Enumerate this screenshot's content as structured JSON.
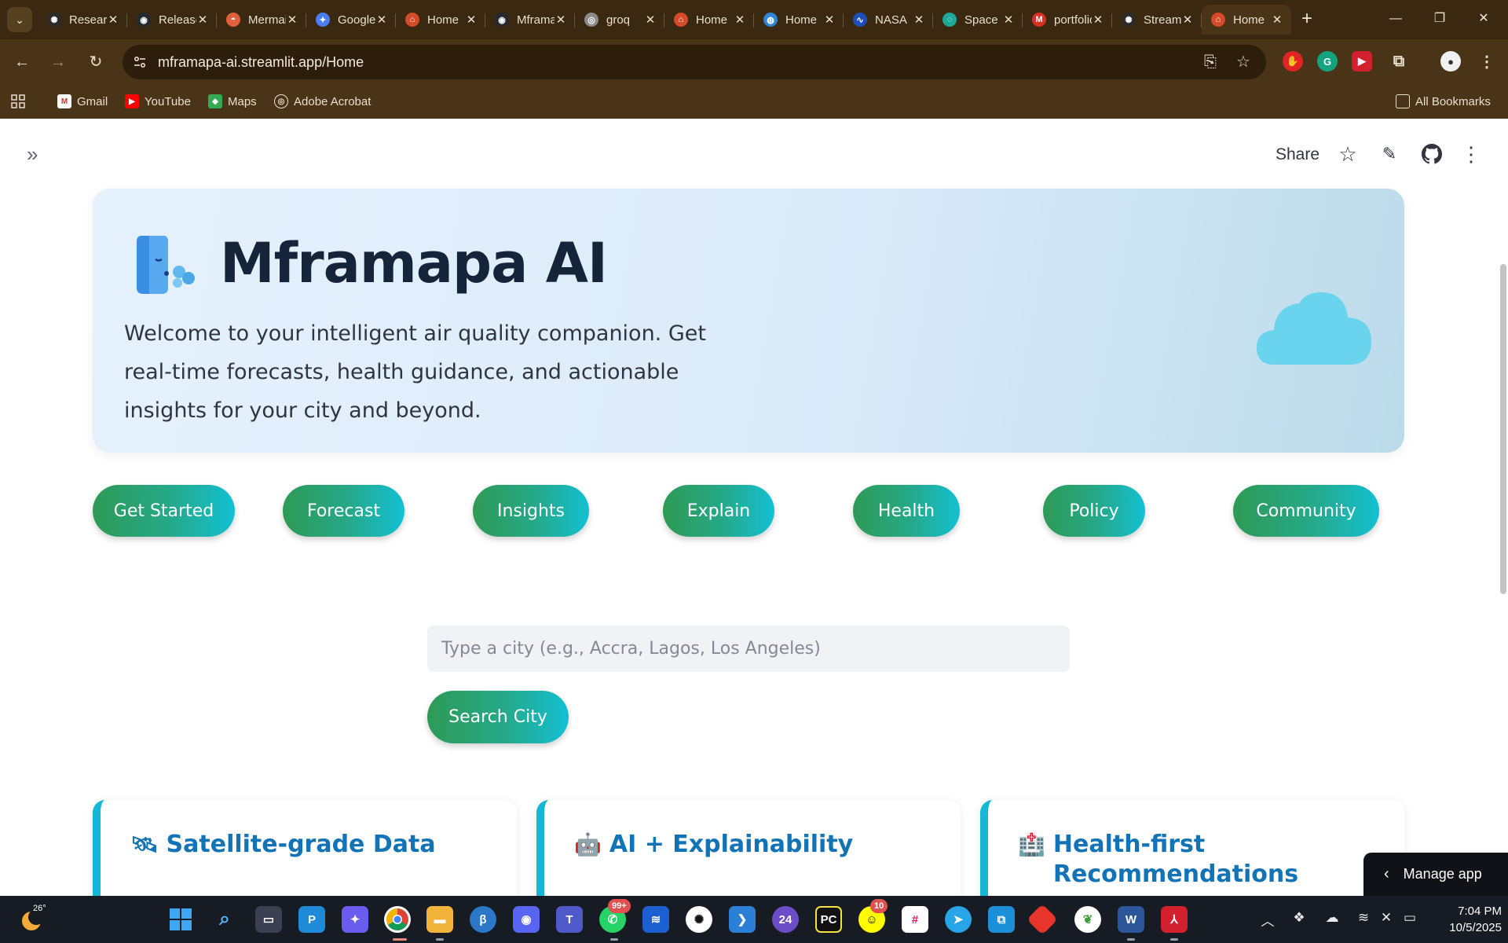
{
  "browser": {
    "tabs": [
      {
        "title": "Research",
        "favicon": "openai-icon",
        "color": "#2b2b2b"
      },
      {
        "title": "Releases",
        "favicon": "github-icon",
        "color": "#24292f"
      },
      {
        "title": "Mermaid",
        "favicon": "mermaid-icon",
        "color": "#e0603c"
      },
      {
        "title": "Google",
        "favicon": "gemini-icon",
        "color": "#4a7ef0"
      },
      {
        "title": "Home",
        "favicon": "house-icon",
        "color": "#d44a2a"
      },
      {
        "title": "Mframapa",
        "favicon": "github-icon",
        "color": "#24292f"
      },
      {
        "title": "groq",
        "favicon": "globe-icon",
        "color": "#8a8a8a"
      },
      {
        "title": "Home",
        "favicon": "house-icon",
        "color": "#d44a2a"
      },
      {
        "title": "Home",
        "favicon": "earth-icon",
        "color": "#2f86d6"
      },
      {
        "title": "NASA",
        "favicon": "nasa-icon",
        "color": "#1d4fb8"
      },
      {
        "title": "Space",
        "favicon": "space-icon",
        "color": "#1da89a"
      },
      {
        "title": "portfolio",
        "favicon": "gmail-icon",
        "color": "#d93025"
      },
      {
        "title": "Streamlit",
        "favicon": "openai-icon",
        "color": "#2b2b2b"
      },
      {
        "title": "Home",
        "favicon": "house-icon",
        "color": "#d44a2a"
      }
    ],
    "url": "mframapa-ai.streamlit.app/Home",
    "bookmarks": [
      "Gmail",
      "YouTube",
      "Maps",
      "Adobe Acrobat"
    ],
    "all_bookmarks": "All Bookmarks"
  },
  "app": {
    "share": "Share",
    "hero": {
      "title": "Mframapa AI",
      "text": "Welcome to your intelligent air quality companion. Get real-time forecasts, health guidance, and actionable insights for your city and beyond."
    },
    "nav_pills": [
      "Get Started",
      "Forecast",
      "Insights",
      "Explain",
      "Health",
      "Policy",
      "Community"
    ],
    "search": {
      "placeholder": "Type a city (e.g., Accra, Lagos, Los Angeles)",
      "button": "Search City"
    },
    "cards": [
      {
        "emoji": "🛰",
        "title": "Satellite-grade Data"
      },
      {
        "emoji": "🤖",
        "title": "AI + Explainability"
      },
      {
        "emoji": "🏥",
        "title": "Health-first Recommendations"
      }
    ],
    "manage_app": "Manage app"
  },
  "taskbar": {
    "temperature": "26°",
    "badges": {
      "whatsapp": "99+",
      "snapchat": "10"
    },
    "clock_time": "7:04 PM",
    "clock_date": "10/5/2025"
  }
}
